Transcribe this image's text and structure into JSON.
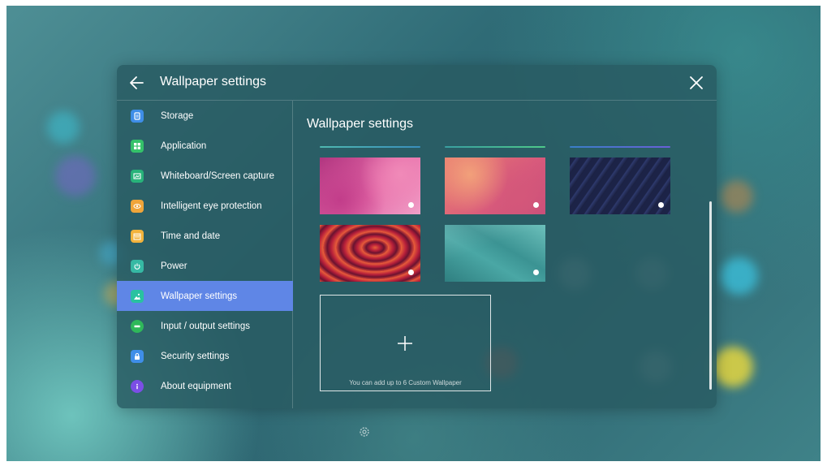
{
  "window": {
    "title": "Wallpaper settings",
    "back_icon": "back-arrow-icon",
    "close_icon": "close-icon"
  },
  "sidebar": {
    "active_index": 6,
    "active_color": "#5f86e6",
    "items": [
      {
        "label": "Storage",
        "icon": "storage-icon",
        "icon_color": "#3f8ee8"
      },
      {
        "label": "Application",
        "icon": "application-icon",
        "icon_color": "#35c26a"
      },
      {
        "label": "Whiteboard/Screen capture",
        "icon": "screen-capture-icon",
        "icon_color": "#28b37a"
      },
      {
        "label": "Intelligent eye protection",
        "icon": "eye-protection-icon",
        "icon_color": "#f0a53a"
      },
      {
        "label": "Time and date",
        "icon": "calendar-icon",
        "icon_color": "#f3b33c"
      },
      {
        "label": "Power",
        "icon": "power-icon",
        "icon_color": "#36b9a4"
      },
      {
        "label": "Wallpaper settings",
        "icon": "wallpaper-icon",
        "icon_color": "#29c2a0"
      },
      {
        "label": "Input / output settings",
        "icon": "input-output-icon",
        "icon_color": "#2fb85a"
      },
      {
        "label": "Security settings",
        "icon": "lock-icon",
        "icon_color": "#3f8ee8"
      },
      {
        "label": "About equipment",
        "icon": "info-icon",
        "icon_color": "#7b4ee6"
      }
    ]
  },
  "content": {
    "title": "Wallpaper settings",
    "wallpapers": [
      {
        "name": "pink-blur-wallpaper",
        "selected": false
      },
      {
        "name": "coral-blur-wallpaper",
        "selected": false
      },
      {
        "name": "dark-architecture-wallpaper",
        "selected": false
      },
      {
        "name": "red-canyon-wallpaper",
        "selected": false
      },
      {
        "name": "teal-polygon-wallpaper",
        "selected": false
      }
    ],
    "add_hint": "You can add up to 6 Custom Wallpaper"
  },
  "dock": {
    "gear_icon": "gear-icon"
  }
}
